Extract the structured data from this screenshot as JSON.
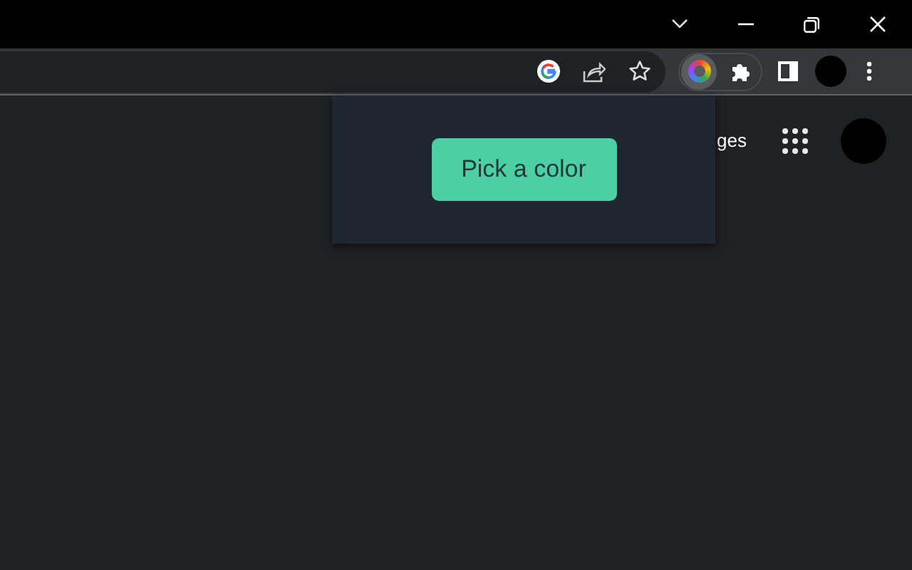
{
  "page_header": {
    "link": "ges"
  },
  "popup": {
    "button": "Pick a color"
  }
}
